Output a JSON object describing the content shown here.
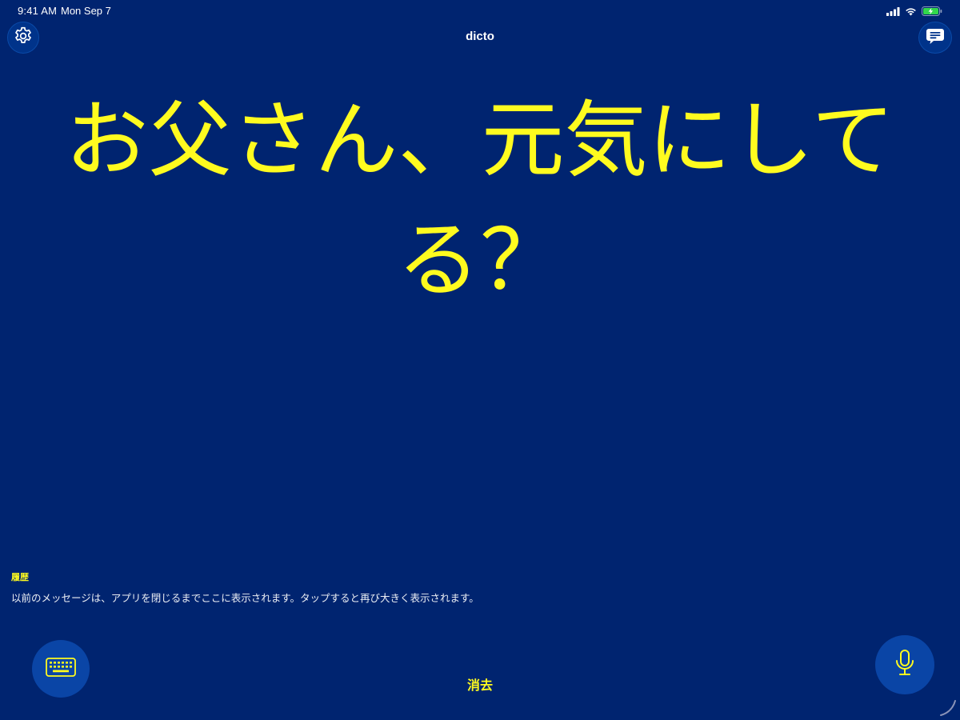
{
  "status_bar": {
    "time": "9:41 AM",
    "date": "Mon Sep 7",
    "icons": [
      "cellular-signal-icon",
      "wifi-icon",
      "battery-charging-icon"
    ]
  },
  "nav": {
    "title": "dicto",
    "left_icon": "gear-icon",
    "right_icon": "chat-bubble-icon"
  },
  "main": {
    "message": "お父さん、元気にしてる？"
  },
  "history": {
    "heading": "履歴",
    "description": "以前のメッセージは、アプリを閉じるまでここに表示されます。タップすると再び大きく表示されます。"
  },
  "bottom": {
    "keyboard_icon": "keyboard-icon",
    "clear_label": "消去",
    "mic_icon": "microphone-icon"
  },
  "colors": {
    "background": "#002470",
    "text_accent": "#fffb1f",
    "button_fill": "#0a45a6",
    "battery_green": "#32d74b"
  }
}
